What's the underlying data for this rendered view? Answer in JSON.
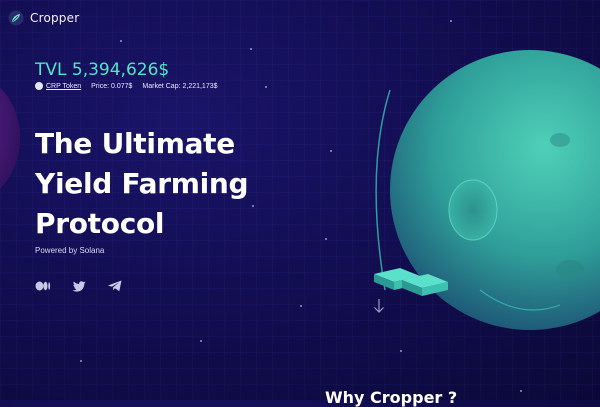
{
  "header": {
    "brand": "Cropper",
    "logo_icon": "cropper-logo-icon"
  },
  "hero": {
    "tvl": "TVL 5,394,626$",
    "token_label": "CRP Token",
    "price": "Price: 0.077$",
    "market_cap": "Market Cap: 2,221,173$",
    "headline": [
      "The Ultimate",
      "Yield Farming",
      "Protocol"
    ],
    "powered_by": "Powered by Solana"
  },
  "socials": [
    {
      "icon": "medium-icon"
    },
    {
      "icon": "twitter-icon"
    },
    {
      "icon": "telegram-icon"
    }
  ],
  "scroll_icon": "arrow-down-icon",
  "next_section_heading": "Why Cropper ?",
  "colors": {
    "background": "#120e52",
    "accent": "#51e6c3",
    "planet": "#3fb7a9",
    "text": "#ffffff"
  }
}
